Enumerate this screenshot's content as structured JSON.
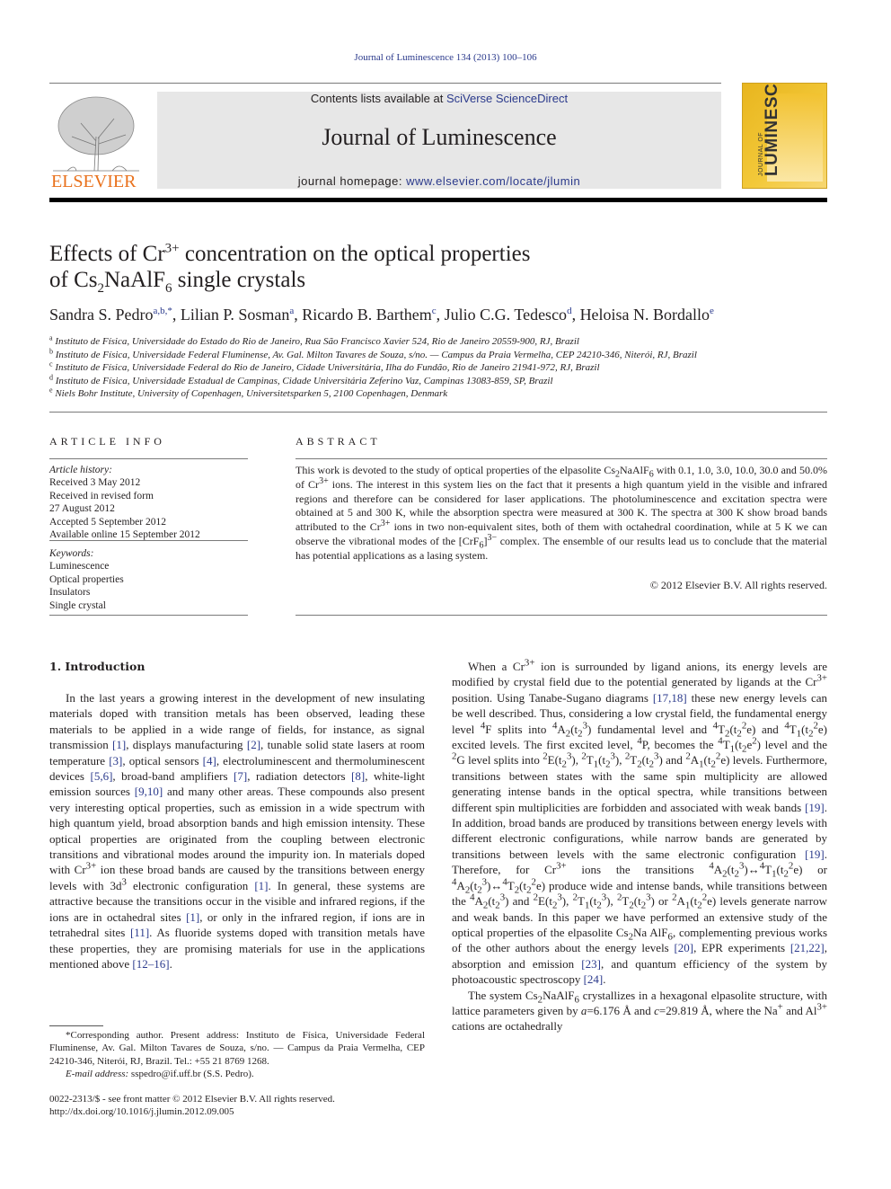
{
  "header": {
    "journal_ref": "Journal of Luminescence 134 (2013) 100–106",
    "contents_prefix": "Contents lists available at ",
    "contents_link": "SciVerse ScienceDirect",
    "journal_title": "Journal of Luminescence",
    "homepage_prefix": "journal homepage: ",
    "homepage_link": "www.elsevier.com/locate/jlumin",
    "publisher_logo_text": "ELSEVIER",
    "cover_small_text": "JOURNAL OF",
    "cover_title": "LUMINESCENCE",
    "colors": {
      "link": "#2b3a8c",
      "elsevier_orange": "#e9711c",
      "cover_yellow": "#f0bf2b",
      "header_box": "#e7e7e7"
    }
  },
  "article": {
    "title_line1_a": "Effects of Cr",
    "title_line1_sup": "3+",
    "title_line1_b": " concentration on the optical properties",
    "title_line2_a": "of Cs",
    "title_line2_sub1": "2",
    "title_line2_b": "NaAlF",
    "title_line2_sub2": "6",
    "title_line2_c": " single crystals",
    "authors": [
      {
        "name": "Sandra S. Pedro",
        "aff": "a,b,*"
      },
      {
        "name": "Lilian P. Sosman",
        "aff": "a"
      },
      {
        "name": "Ricardo B. Barthem",
        "aff": "c"
      },
      {
        "name": "Julio C.G. Tedesco",
        "aff": "d"
      },
      {
        "name": "Heloisa N. Bordallo",
        "aff": "e"
      }
    ],
    "affiliations": [
      {
        "key": "a",
        "text": "Instituto de Física, Universidade do Estado do Rio de Janeiro, Rua São Francisco Xavier 524, Rio de Janeiro 20559-900, RJ, Brazil"
      },
      {
        "key": "b",
        "text": "Instituto de Física, Universidade Federal Fluminense, Av. Gal. Milton Tavares de Souza, s/no. — Campus da Praia Vermelha, CEP 24210-346, Niterói, RJ, Brazil"
      },
      {
        "key": "c",
        "text": "Instituto de Física, Universidade Federal do Rio de Janeiro, Cidade Universitária, Ilha do Fundão, Rio de Janeiro 21941-972, RJ, Brazil"
      },
      {
        "key": "d",
        "text": "Instituto de Física, Universidade Estadual de Campinas, Cidade Universitária Zeferino Vaz, Campinas 13083-859, SP, Brazil"
      },
      {
        "key": "e",
        "text": "Niels Bohr Institute, University of Copenhagen, Universitetsparken 5, 2100 Copenhagen, Denmark"
      }
    ]
  },
  "article_info": {
    "heading": "ARTICLE INFO",
    "history_label": "Article history:",
    "history": [
      "Received 3 May 2012",
      "Received in revised form",
      "27 August 2012",
      "Accepted 5 September 2012",
      "Available online 15 September 2012"
    ],
    "keywords_label": "Keywords:",
    "keywords": [
      "Luminescence",
      "Optical properties",
      "Insulators",
      "Single crystal"
    ]
  },
  "abstract": {
    "heading": "ABSTRACT",
    "t1": "This work is devoted to the study of optical properties of the elpasolite Cs",
    "t2": "NaAlF",
    "t3": " with 0.1, 1.0, 3.0, 10.0, 30.0 and 50.0% of Cr",
    "t4": " ions. The interest in this system lies on the fact that it presents a high quantum yield in the visible and infrared regions and therefore can be considered for laser applications. The photoluminescence and excitation spectra were obtained at 5 and 300 K, while the absorption spectra were measured at 300 K. The spectra at 300 K show broad bands attributed to the Cr",
    "t5": " ions in two non-equivalent sites, both of them with octahedral coordination, while at 5 K we can observe the vibrational modes of the [CrF",
    "t6": "]",
    "t7": " complex. The ensemble of our results lead us to conclude that the material has potential applications as a lasing system.",
    "copyright": "© 2012 Elsevier B.V. All rights reserved."
  },
  "intro": {
    "heading": "1.  Introduction"
  },
  "footnote": {
    "corresponding": "*Corresponding author. Present address: Instituto de Física, Universidade Federal Fluminense, Av. Gal. Milton Tavares de Souza, s/no. — Campus da Praia Vermelha, CEP 24210-346, Niterói, RJ, Brazil. Tel.: +55 21 8769 1268.",
    "email_label": "E-mail address:",
    "email": " sspedro@if.uff.br (S.S. Pedro).",
    "front_matter": "0022-2313/$ - see front matter © 2012 Elsevier B.V. All rights reserved.",
    "doi": "http://dx.doi.org/10.1016/j.jlumin.2012.09.005"
  }
}
